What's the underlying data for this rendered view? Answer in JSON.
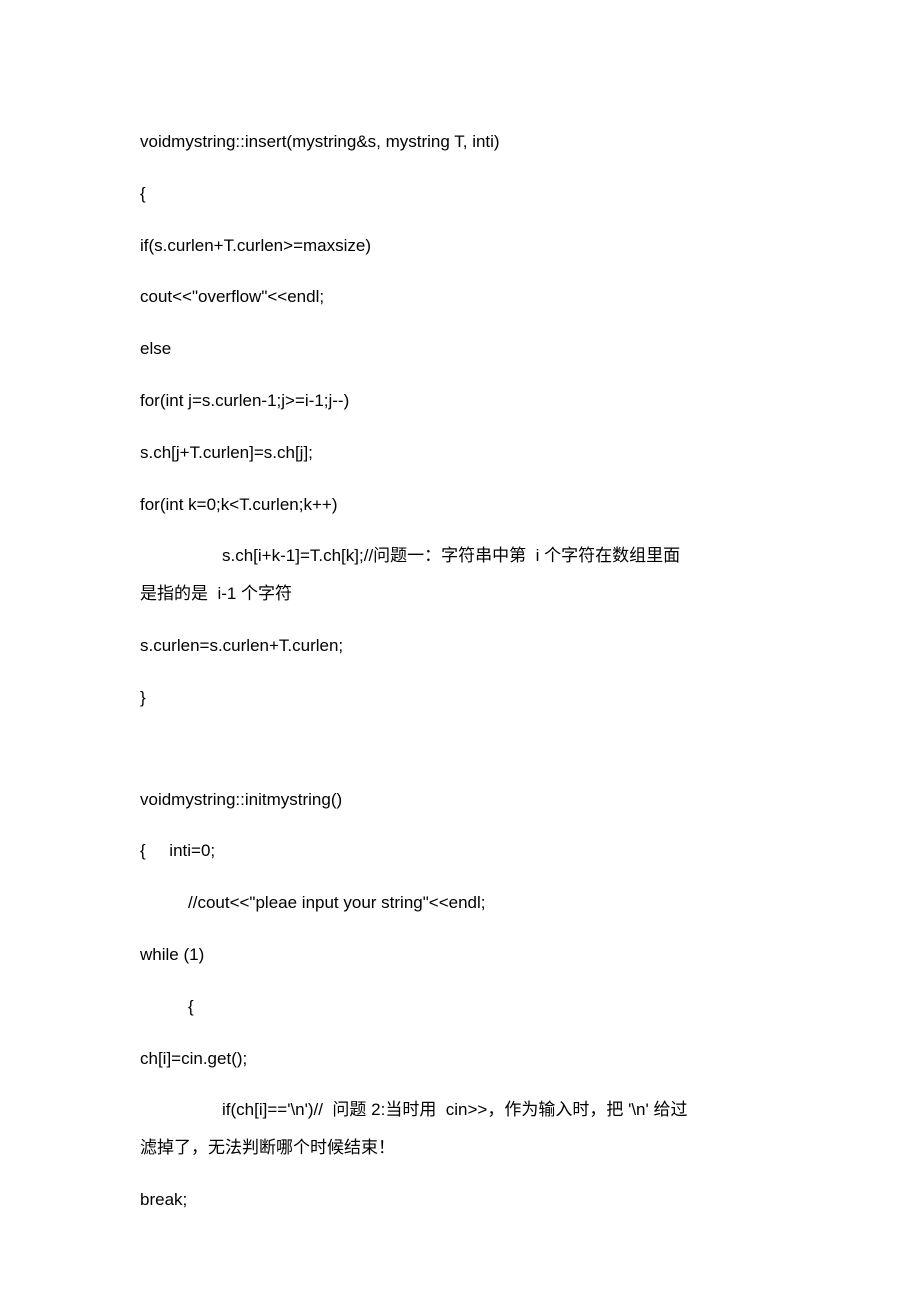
{
  "lines": {
    "l1": "voidmystring::insert(mystring&s, mystring T, inti)",
    "l2": "{",
    "l3": "if(s.curlen+T.curlen>=maxsize)",
    "l4": "cout<<\"overflow\"<<endl;",
    "l5": "else",
    "l6": "for(int j=s.curlen-1;j>=i-1;j--)",
    "l7": "s.ch[j+T.curlen]=s.ch[j];",
    "l8": "for(int k=0;k<T.curlen;k++)",
    "l9a": "s.ch[i+k-1]=T.ch[k];//问题一：字符串中第  i 个字符在数组里面",
    "l9b": "是指的是  i-1 个字符",
    "l10": "s.curlen=s.curlen+T.curlen;",
    "l11": "}",
    "l12": "voidmystring::initmystring()",
    "l13": "{     inti=0;",
    "l14": "//cout<<\"pleae input your string\"<<endl;",
    "l15": "while (1)",
    "l16": "{",
    "l17": "ch[i]=cin.get();",
    "l18a": "if(ch[i]=='\\n')//  问题 2:当时用  cin>>，作为输入时，把 '\\n' 给过",
    "l18b": "滤掉了，无法判断哪个时候结束！",
    "l19": "break;"
  }
}
